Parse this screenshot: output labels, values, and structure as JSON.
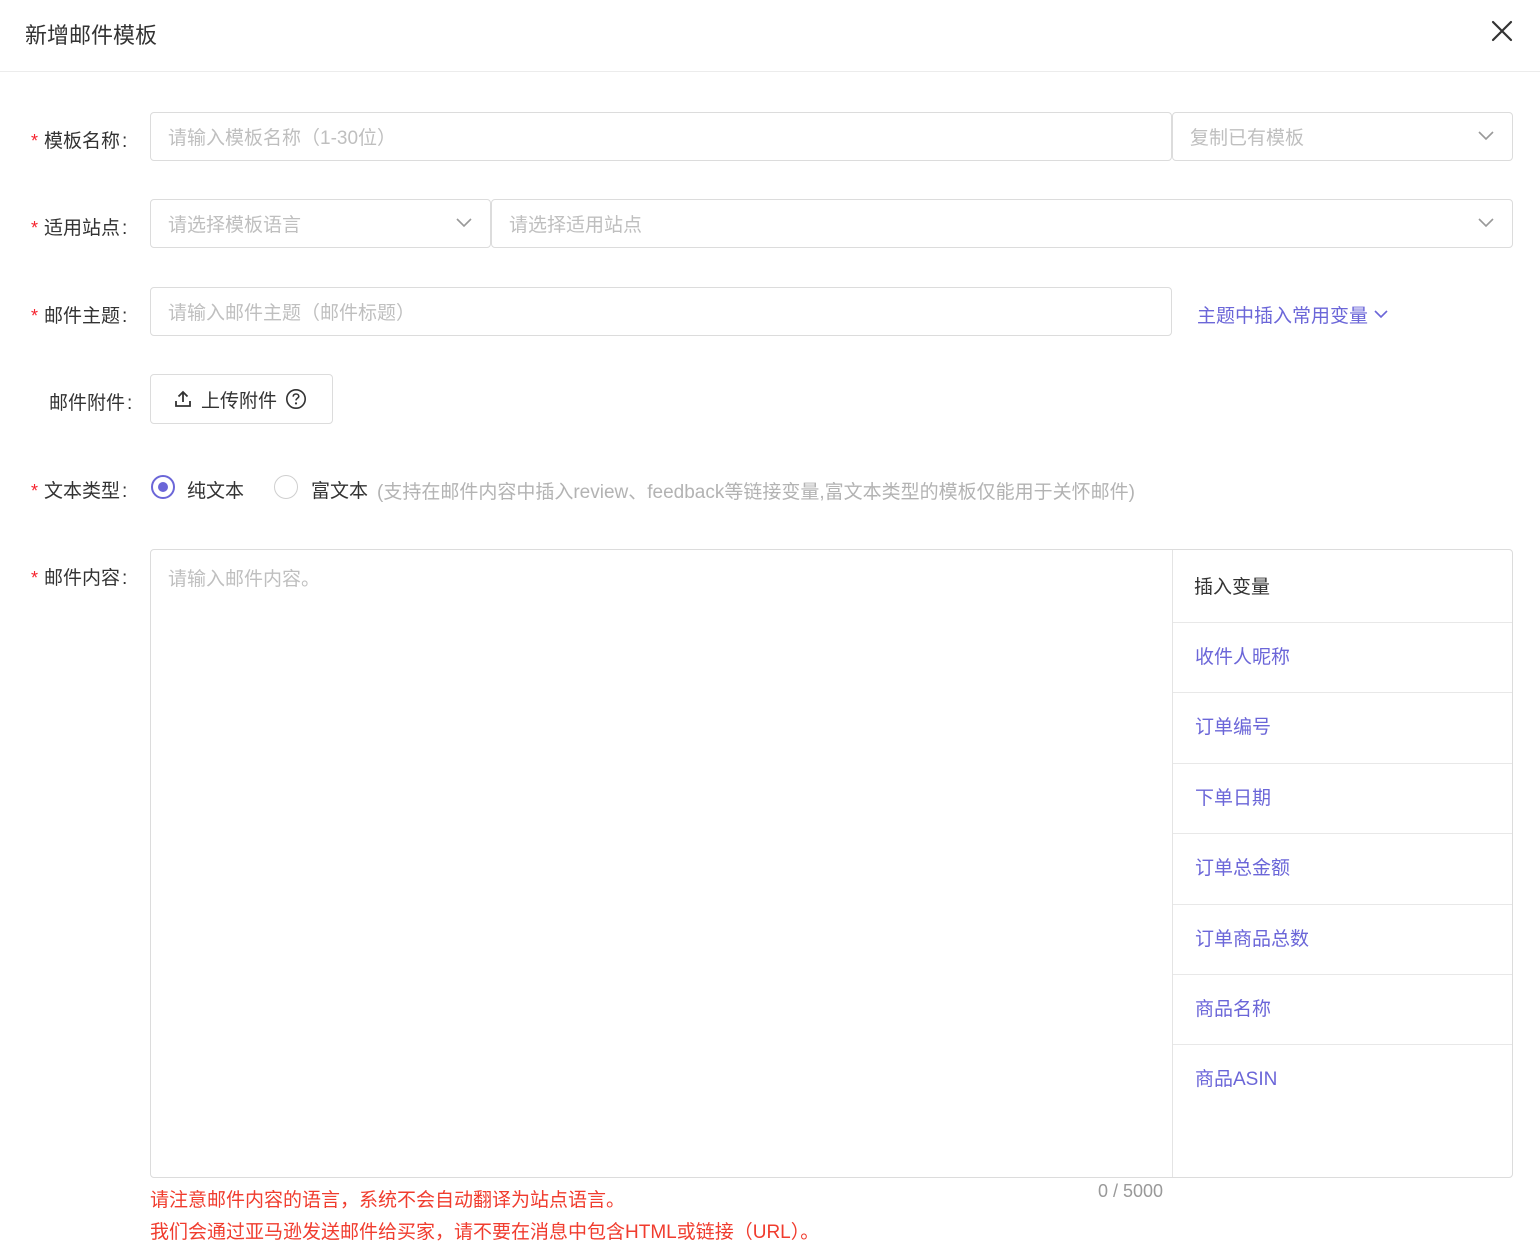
{
  "dialog": {
    "title": "新增邮件模板"
  },
  "form": {
    "template_name": {
      "label": "模板名称",
      "placeholder": "请输入模板名称（1-30位）",
      "copy_placeholder": "复制已有模板"
    },
    "site": {
      "label": "适用站点",
      "language_placeholder": "请选择模板语言",
      "site_placeholder": "请选择适用站点"
    },
    "subject": {
      "label": "邮件主题",
      "placeholder": "请输入邮件主题（邮件标题）",
      "insert_link": "主题中插入常用变量"
    },
    "attachment": {
      "label": "邮件附件",
      "upload_label": "上传附件"
    },
    "text_type": {
      "label": "文本类型",
      "options": [
        "纯文本",
        "富文本"
      ],
      "selected": "纯文本",
      "hint": "(支持在邮件内容中插入review、feedback等链接变量,富文本类型的模板仅能用于关怀邮件)"
    },
    "content": {
      "label": "邮件内容",
      "placeholder": "请输入邮件内容。",
      "counter": "0 / 5000",
      "warnings": [
        "请注意邮件内容的语言，系统不会自动翻译为站点语言。",
        "我们会通过亚马逊发送邮件给买家，请不要在消息中包含HTML或链接（URL）。"
      ]
    }
  },
  "variables": {
    "title": "插入变量",
    "items": [
      "收件人昵称",
      "订单编号",
      "下单日期",
      "订单总金额",
      "订单商品总数",
      "商品名称",
      "商品ASIN"
    ]
  },
  "colors": {
    "accent": "#6b66d8",
    "required": "#f5222d",
    "warning": "#f03c2e"
  }
}
